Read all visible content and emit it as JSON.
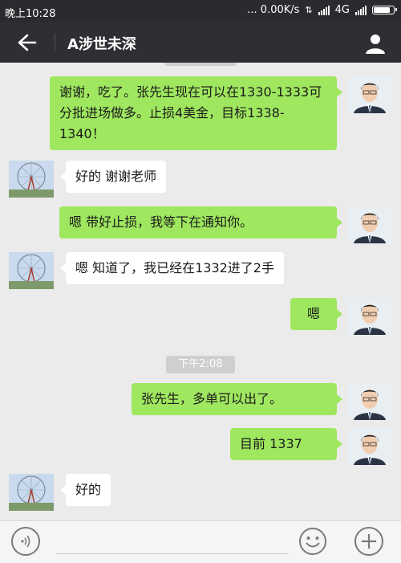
{
  "status_bar": {
    "time": "晚上10:28",
    "net_speed": "... 0.00K/s",
    "network": "4G"
  },
  "header": {
    "title": "A涉世未深"
  },
  "messages": [
    {
      "side": "out",
      "text": "谢谢，吃了。张先生现在可以在1330-1333可分批进场做多。止损4美金，目标1338-1340！"
    },
    {
      "side": "in",
      "text": "好的   谢谢老师"
    },
    {
      "side": "out",
      "text": "嗯    带好止损，我等下在通知你。"
    },
    {
      "side": "in",
      "text": "嗯  知道了，我已经在1332进了2手"
    },
    {
      "side": "out",
      "text": "嗯"
    },
    {
      "side": "out",
      "text": "张先生，多单可以出了。"
    },
    {
      "side": "out",
      "text": "目前  1337"
    },
    {
      "side": "in",
      "text": "好的"
    }
  ],
  "timestamp_label": "下午2:08",
  "icons": {
    "back": "back-arrow-icon",
    "profile": "person-icon",
    "voice": "voice-icon",
    "emoji": "emoji-icon",
    "plus": "plus-icon"
  }
}
